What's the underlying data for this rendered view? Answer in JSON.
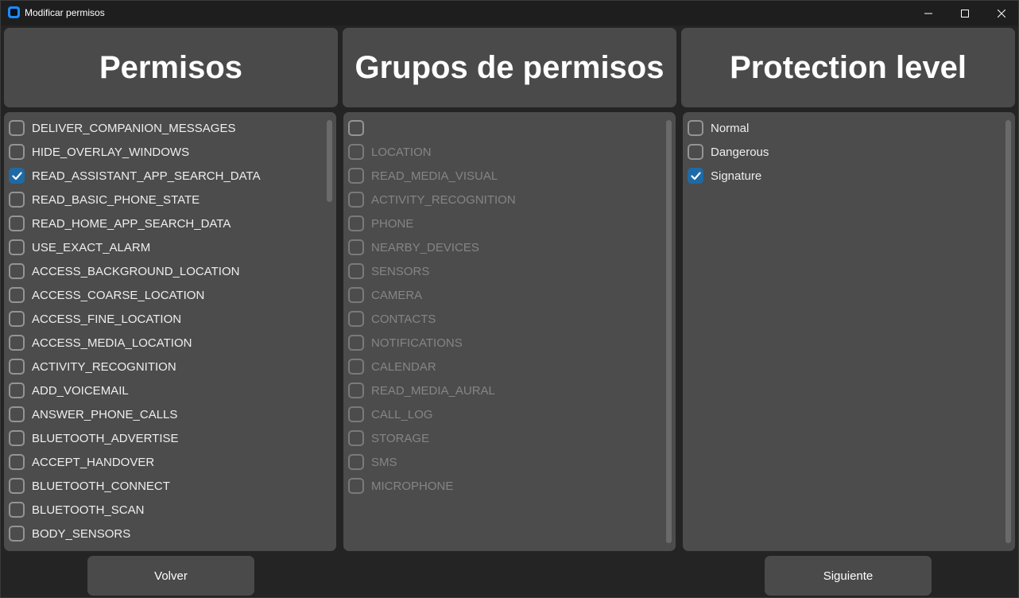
{
  "window": {
    "title": "Modificar permisos"
  },
  "headers": {
    "permisos": "Permisos",
    "grupos": "Grupos de permisos",
    "protection": "Protection level"
  },
  "permisos": [
    {
      "label": "DELIVER_COMPANION_MESSAGES",
      "checked": false
    },
    {
      "label": "HIDE_OVERLAY_WINDOWS",
      "checked": false
    },
    {
      "label": "READ_ASSISTANT_APP_SEARCH_DATA",
      "checked": true
    },
    {
      "label": "READ_BASIC_PHONE_STATE",
      "checked": false
    },
    {
      "label": "READ_HOME_APP_SEARCH_DATA",
      "checked": false
    },
    {
      "label": "USE_EXACT_ALARM",
      "checked": false
    },
    {
      "label": "ACCESS_BACKGROUND_LOCATION",
      "checked": false
    },
    {
      "label": "ACCESS_COARSE_LOCATION",
      "checked": false
    },
    {
      "label": "ACCESS_FINE_LOCATION",
      "checked": false
    },
    {
      "label": "ACCESS_MEDIA_LOCATION",
      "checked": false
    },
    {
      "label": "ACTIVITY_RECOGNITION",
      "checked": false
    },
    {
      "label": "ADD_VOICEMAIL",
      "checked": false
    },
    {
      "label": "ANSWER_PHONE_CALLS",
      "checked": false
    },
    {
      "label": "BLUETOOTH_ADVERTISE",
      "checked": false
    },
    {
      "label": "ACCEPT_HANDOVER",
      "checked": false
    },
    {
      "label": "BLUETOOTH_CONNECT",
      "checked": false
    },
    {
      "label": "BLUETOOTH_SCAN",
      "checked": false
    },
    {
      "label": "BODY_SENSORS",
      "checked": false
    }
  ],
  "grupos": [
    {
      "label": "",
      "checked": false,
      "disabled": false
    },
    {
      "label": "LOCATION",
      "checked": false,
      "disabled": true
    },
    {
      "label": "READ_MEDIA_VISUAL",
      "checked": false,
      "disabled": true
    },
    {
      "label": "ACTIVITY_RECOGNITION",
      "checked": false,
      "disabled": true
    },
    {
      "label": "PHONE",
      "checked": false,
      "disabled": true
    },
    {
      "label": "NEARBY_DEVICES",
      "checked": false,
      "disabled": true
    },
    {
      "label": "SENSORS",
      "checked": false,
      "disabled": true
    },
    {
      "label": "CAMERA",
      "checked": false,
      "disabled": true
    },
    {
      "label": "CONTACTS",
      "checked": false,
      "disabled": true
    },
    {
      "label": "NOTIFICATIONS",
      "checked": false,
      "disabled": true
    },
    {
      "label": "CALENDAR",
      "checked": false,
      "disabled": true
    },
    {
      "label": "READ_MEDIA_AURAL",
      "checked": false,
      "disabled": true
    },
    {
      "label": "CALL_LOG",
      "checked": false,
      "disabled": true
    },
    {
      "label": "STORAGE",
      "checked": false,
      "disabled": true
    },
    {
      "label": "SMS",
      "checked": false,
      "disabled": true
    },
    {
      "label": "MICROPHONE",
      "checked": false,
      "disabled": true
    }
  ],
  "protection": [
    {
      "label": "Normal",
      "checked": false
    },
    {
      "label": "Dangerous",
      "checked": false
    },
    {
      "label": "Signature",
      "checked": true
    }
  ],
  "buttons": {
    "back": "Volver",
    "next": "Siguiente"
  },
  "colors": {
    "accent": "#1f6aa5",
    "card": "#4a4a4a",
    "panel": "#4c4c4c",
    "window": "#242424"
  },
  "icons": {
    "app": "app-icon",
    "minimize": "minimize-icon",
    "maximize": "maximize-icon",
    "close": "close-icon",
    "check": "checkmark-icon"
  }
}
